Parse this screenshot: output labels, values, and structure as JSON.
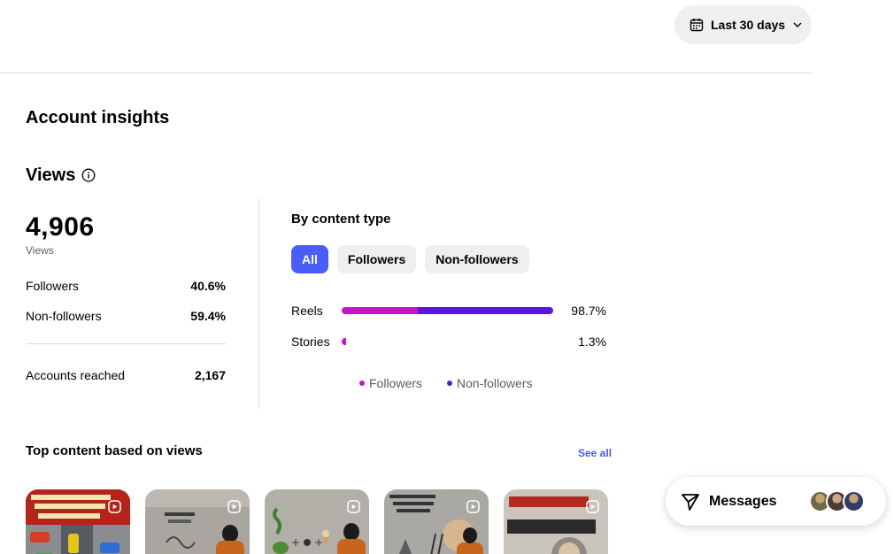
{
  "date_range": {
    "label": "Last 30 days"
  },
  "section_title": "Account insights",
  "views": {
    "heading": "Views",
    "total": "4,906",
    "total_label": "Views",
    "stats": [
      {
        "label": "Followers",
        "value": "40.6%"
      },
      {
        "label": "Non-followers",
        "value": "59.4%"
      }
    ],
    "accounts_reached": {
      "label": "Accounts reached",
      "value": "2,167"
    }
  },
  "by_content_type": {
    "title": "By content type",
    "filters": [
      "All",
      "Followers",
      "Non-followers"
    ],
    "active_filter": "All",
    "rows": [
      {
        "label": "Reels",
        "pct": "98.7%",
        "total": 98.7,
        "followers_share": 0.36
      },
      {
        "label": "Stories",
        "pct": "1.3%",
        "total": 1.3,
        "followers_share": 0.5
      }
    ],
    "legend": [
      {
        "label": "Followers",
        "color": "#c515c8"
      },
      {
        "label": "Non-followers",
        "color": "#5b14d9"
      }
    ]
  },
  "top_content": {
    "title": "Top content based on views",
    "see_all": "See all",
    "thumbnails": [
      {
        "name": "thumb-traffic-puzzle"
      },
      {
        "name": "thumb-pass-fail"
      },
      {
        "name": "thumb-snake-math"
      },
      {
        "name": "thumb-ladder-puzzle"
      },
      {
        "name": "thumb-genius-math"
      }
    ]
  },
  "messages": {
    "label": "Messages"
  },
  "colors": {
    "accent": "#4a5df9",
    "followers": "#c515c8",
    "non_followers": "#5b14d9"
  }
}
